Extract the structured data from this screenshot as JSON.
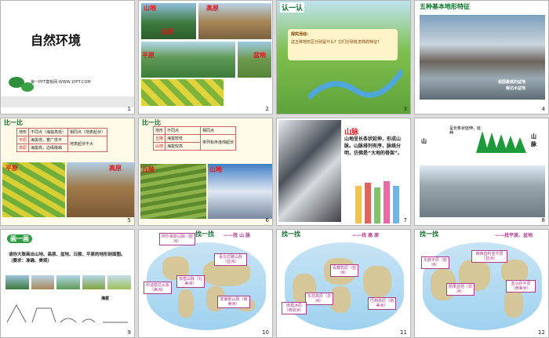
{
  "slides": [
    {
      "num": "1",
      "title": "自然环境",
      "footer": "第一PPT模板网-WWW.1PPT.COM"
    },
    {
      "num": "2",
      "labels": [
        "山地",
        "高原",
        "丘陵",
        "平原",
        "盆地"
      ]
    },
    {
      "num": "3",
      "heading": "认一认",
      "prompt": "探究活动：",
      "question": "这五种地形区分别是什么？它们分别有怎样的特征？"
    },
    {
      "num": "4",
      "heading": "五种基本地形特征",
      "caption1": "我国最高的盆地",
      "caption2": "柴达木盆地"
    },
    {
      "num": "5",
      "heading": "比一比",
      "table": [
        [
          "地形",
          "不同点（海拔高低）",
          "相同点（地表起伏）"
        ],
        [
          "平原",
          "海拔低，宽广低平",
          "地表起伏不大"
        ],
        [
          "高原",
          "海拔高，边缘陡峭",
          ""
        ]
      ],
      "labels": [
        "平原",
        "高原"
      ]
    },
    {
      "num": "6",
      "heading": "比一比",
      "table": [
        [
          "地形",
          "不同点",
          "相同点"
        ],
        [
          "丘陵",
          "海拔较低",
          "排列有序连绵起伏"
        ],
        [
          "山地",
          "海拔较高",
          ""
        ]
      ],
      "labels": [
        "丘陵",
        "山地"
      ]
    },
    {
      "num": "7",
      "title": "山脉",
      "text": "山地呈长条状延伸，形成山脉。山脉排列有序，脉络分明，仿佛是“大地的骨架”。"
    },
    {
      "num": "8",
      "left": "山",
      "mid": "呈长条状延伸，延伸",
      "right": "山脉"
    },
    {
      "num": "9",
      "heading": "画一画",
      "text": "请你大致画出山地、高原、盆地、丘陵、平原的地形剖面图。（要求：准确、美观）",
      "sub": "海拔"
    },
    {
      "num": "10",
      "heading": "找一找",
      "sub": "——找 山 脉",
      "tags": [
        "阿尔卑斯山脉（欧洲）",
        "喜马拉雅山脉（亚洲）",
        "落基山脉（北美洲）",
        "安第斯山脉（南美洲）",
        "科迪勒拉山系（美洲）"
      ]
    },
    {
      "num": "11",
      "heading": "找一找",
      "sub": "——找 高 原",
      "tags": [
        "青藏高原（亚洲）",
        "巴西高原（南美洲）",
        "东非高原（非洲）",
        "南极冰原（南极洲）"
      ]
    },
    {
      "num": "12",
      "heading": "找一找",
      "sub": "——找平原、盆地",
      "tags": [
        "东欧平原（欧洲）",
        "西西伯利亚平原（亚洲）",
        "亚马孙平原（南美洲）",
        "刚果盆地（非洲）"
      ]
    }
  ]
}
